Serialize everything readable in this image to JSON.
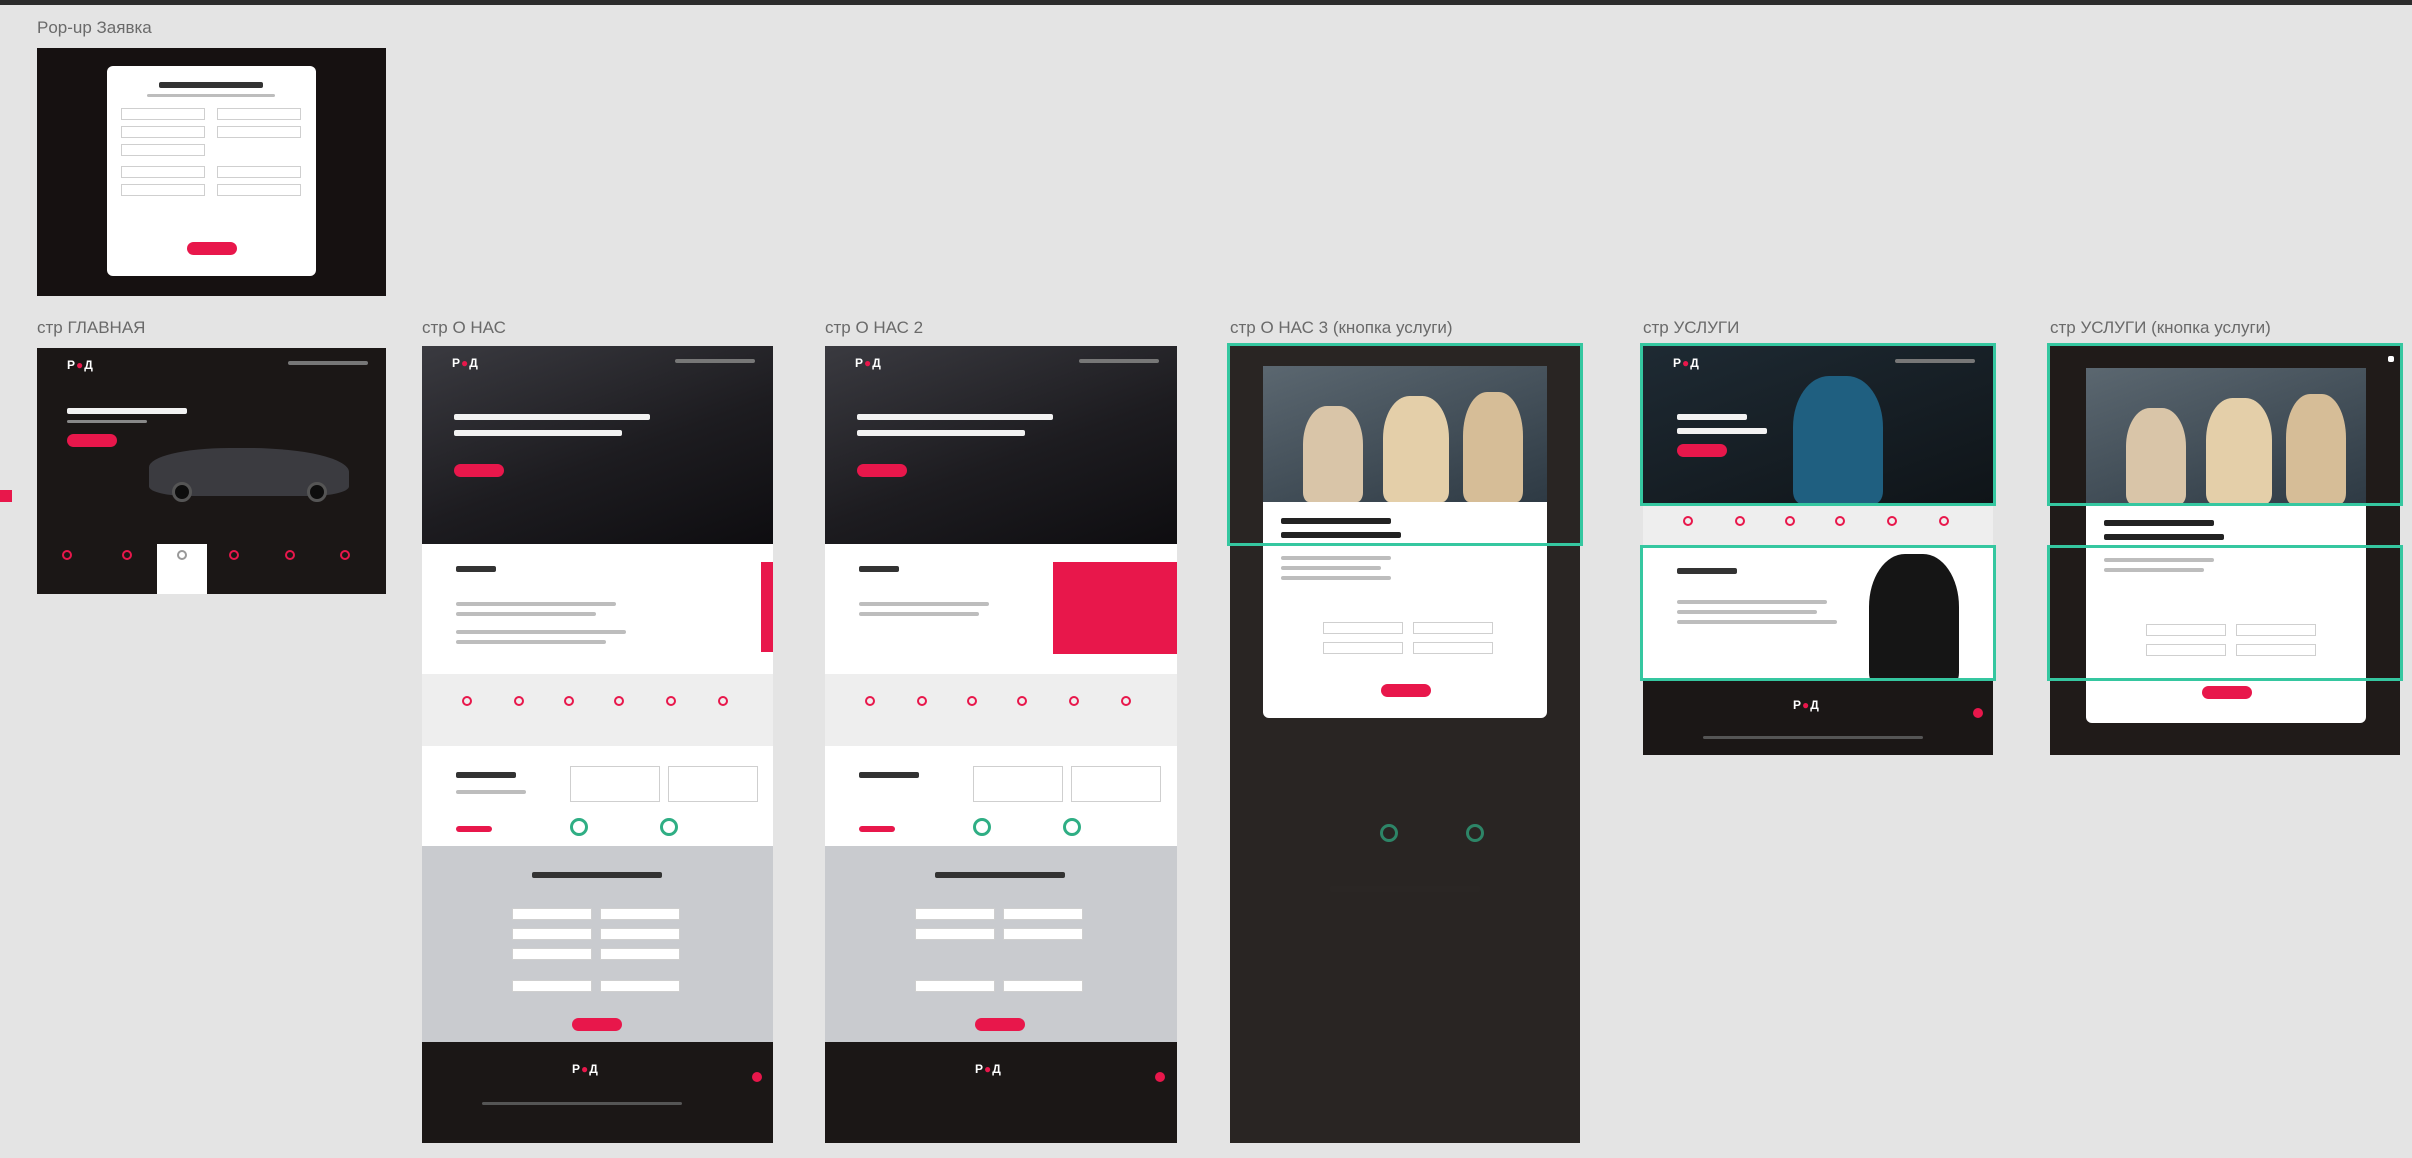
{
  "canvas": {
    "frames": [
      {
        "id": "popup",
        "label": "Pop-up Заявка"
      },
      {
        "id": "home",
        "label": "стр ГЛАВНАЯ"
      },
      {
        "id": "about1",
        "label": "стр О НАС"
      },
      {
        "id": "about2",
        "label": "стр О НАС 2"
      },
      {
        "id": "about3",
        "label": "стр О НАС 3 (кнопка услуги)"
      },
      {
        "id": "services",
        "label": "стр УСЛУГИ"
      },
      {
        "id": "services2",
        "label": "стр УСЛУГИ (кнопка услуги)"
      }
    ]
  },
  "colors": {
    "background": "#e4e4e4",
    "accent": "#e8174b",
    "dark": "#1b1716",
    "selection": "#35c7a0"
  },
  "icons": [
    "person-icon",
    "car-icon",
    "clock-icon",
    "star-icon",
    "shield-icon",
    "phone-icon"
  ]
}
